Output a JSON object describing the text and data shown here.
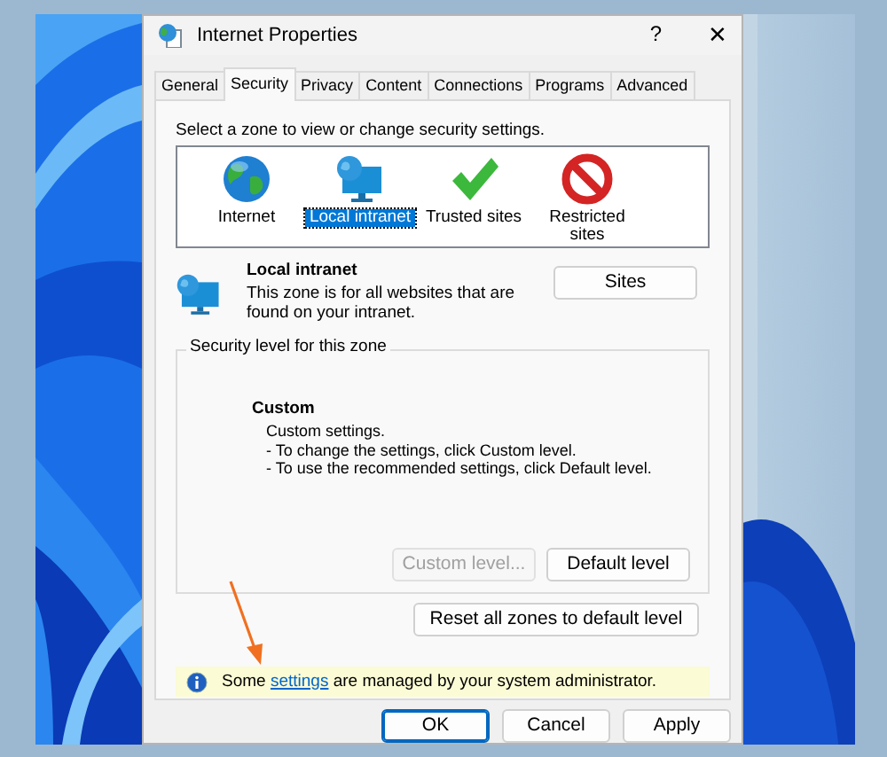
{
  "window": {
    "title": "Internet Properties",
    "help": "?",
    "close": "✕"
  },
  "tabs": [
    {
      "label": "General",
      "selected": false
    },
    {
      "label": "Security",
      "selected": true
    },
    {
      "label": "Privacy",
      "selected": false
    },
    {
      "label": "Content",
      "selected": false
    },
    {
      "label": "Connections",
      "selected": false
    },
    {
      "label": "Programs",
      "selected": false
    },
    {
      "label": "Advanced",
      "selected": false
    }
  ],
  "zones": {
    "prompt": "Select a zone to view or change security settings.",
    "items": [
      {
        "label": "Internet",
        "kind": "globe",
        "selected": false
      },
      {
        "label": "Local intranet",
        "kind": "intranet",
        "selected": true
      },
      {
        "label": "Trusted sites",
        "kind": "check",
        "selected": false
      },
      {
        "label": "Restricted sites",
        "kind": "blocked",
        "selected": false
      }
    ]
  },
  "zone_info": {
    "title": "Local intranet",
    "description": "This zone is for all websites that are found on your intranet.",
    "button": "Sites"
  },
  "security_level": {
    "legend": "Security level for this zone",
    "level_name": "Custom",
    "lines": [
      "Custom settings.",
      "- To change the settings, click Custom level.",
      "- To use the recommended settings, click Default level."
    ],
    "buttons": [
      {
        "label": "Custom level...",
        "disabled": true
      },
      {
        "label": "Default level",
        "disabled": false
      }
    ]
  },
  "reset_button": "Reset all zones to default level",
  "notice": {
    "before": "Some ",
    "link": "settings",
    "after": " are managed by your system administrator."
  },
  "buttons": [
    {
      "label": "OK",
      "focused": true
    },
    {
      "label": "Cancel",
      "focused": false
    },
    {
      "label": "Apply",
      "focused": false
    }
  ]
}
